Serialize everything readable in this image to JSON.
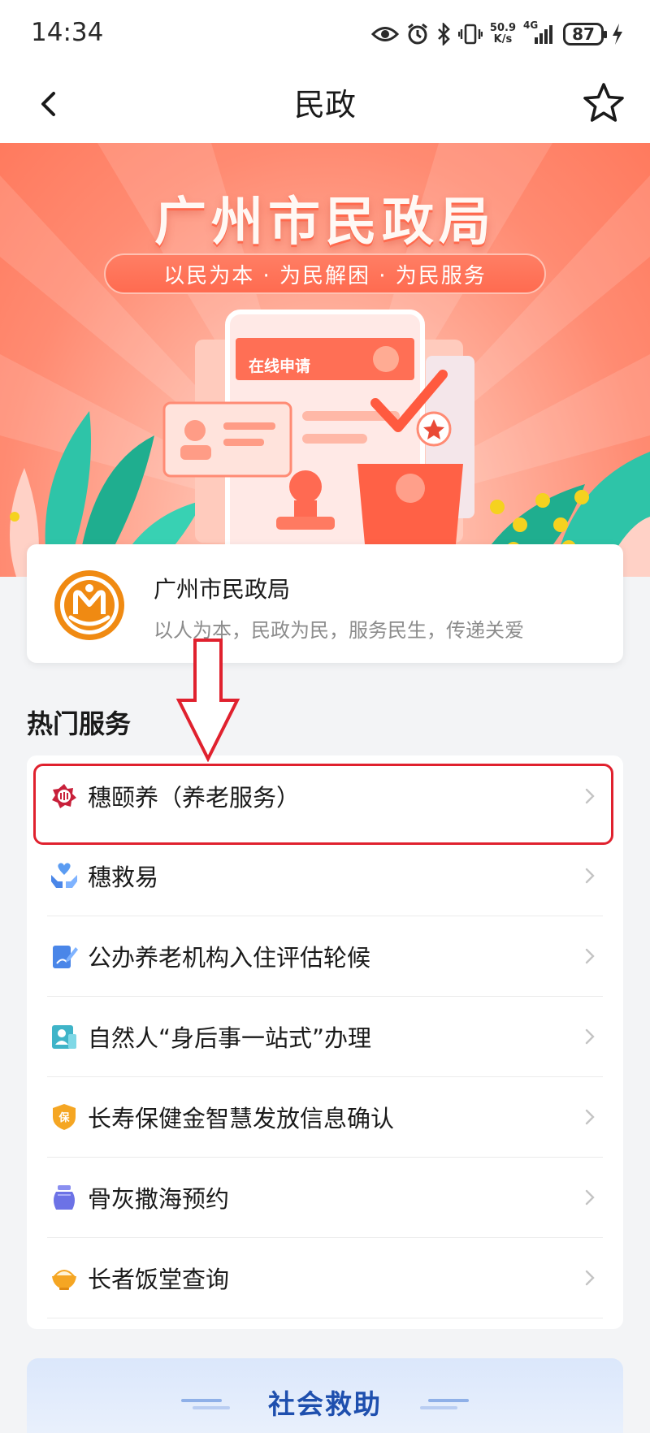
{
  "status_bar": {
    "time": "14:34",
    "net_speed_top": "50.9",
    "net_speed_bottom": "K/s",
    "network": "4G",
    "battery": "87",
    "icons": [
      "eye-icon",
      "alarm-icon",
      "bluetooth-icon",
      "vibrate-icon",
      "signal-icon",
      "battery-icon",
      "charging-icon"
    ]
  },
  "nav": {
    "title": "民政",
    "back_icon": "back-chevron-icon",
    "favorite_icon": "star-outline-icon"
  },
  "banner": {
    "title": "广州市民政局",
    "slogan": "以民为本 · 为民解困 · 为民服务",
    "art_label": "在线申请",
    "colors": {
      "primary": "#ff7a5e",
      "accent": "#e0212e"
    }
  },
  "org_card": {
    "name": "广州市民政局",
    "description": "以人为本，民政为民，服务民生，传递关爱",
    "logo_icon": "civil-affairs-logo-icon"
  },
  "hot_services": {
    "title": "热门服务",
    "items": [
      {
        "label": "穗颐养（养老服务）",
        "icon": "suiyiyang-logo-icon",
        "highlighted": true
      },
      {
        "label": "穗救易",
        "icon": "hands-heart-icon"
      },
      {
        "label": "公办养老机构入住评估轮候",
        "icon": "edit-document-icon"
      },
      {
        "label": "自然人“身后事一站式”办理",
        "icon": "person-card-icon"
      },
      {
        "label": "长寿保健金智慧发放信息确认",
        "icon": "shield-bao-icon"
      },
      {
        "label": "骨灰撒海预约",
        "icon": "urn-icon"
      },
      {
        "label": "长者饭堂查询",
        "icon": "rice-bowl-icon"
      }
    ]
  },
  "bottom_section": {
    "title": "社会救助"
  }
}
